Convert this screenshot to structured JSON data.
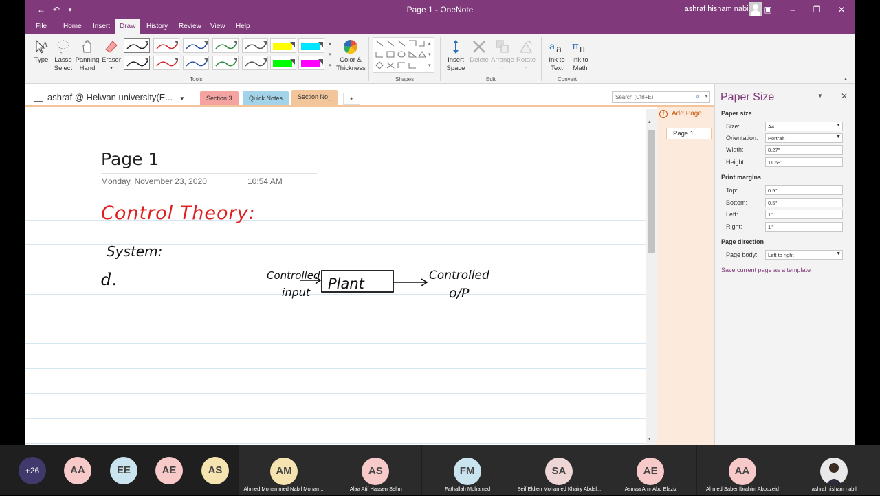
{
  "window": {
    "title": "Page 1  -  OneNote",
    "user": "ashraf hisham nabil"
  },
  "ribbon_tabs": [
    "File",
    "Home",
    "Insert",
    "Draw",
    "History",
    "Review",
    "View",
    "Help"
  ],
  "active_tab": "Draw",
  "ribbon": {
    "type": "Type",
    "lasso": "Lasso\nSelect",
    "lasso_1": "Lasso",
    "lasso_2": "Select",
    "panning_1": "Panning",
    "panning_2": "Hand",
    "eraser": "Eraser",
    "color_1": "Color &",
    "color_2": "Thickness",
    "insert_space_1": "Insert",
    "insert_space_2": "Space",
    "delete": "Delete",
    "arrange": "Arrange",
    "rotate": "Rotate",
    "ink_text_1": "Ink to",
    "ink_text_2": "Text",
    "ink_math_1": "Ink to",
    "ink_math_2": "Math",
    "groups": {
      "tools": "Tools",
      "shapes": "Shapes",
      "edit": "Edit",
      "convert": "Convert"
    },
    "pen_colors": [
      "#222222",
      "#d22a2a",
      "#2c4fa8",
      "#2a8a3a",
      "#555555",
      "#ffff00",
      "#00e5ff",
      "#222222",
      "#d22a2a",
      "#2c4fa8",
      "#2a8a3a",
      "#555555",
      "#00ff00",
      "#ff00ff"
    ]
  },
  "notebook": {
    "name": "ashraf @ Helwan university(E...",
    "sections": [
      {
        "label": "Section 3",
        "color": "#f4a3a0"
      },
      {
        "label": "Quick Notes",
        "color": "#a3d3e8"
      },
      {
        "label": "Section No_",
        "color": "#f2c59b"
      }
    ],
    "add_section": "+",
    "search_placeholder": "Search (Ctrl+E)"
  },
  "page": {
    "title": "Page 1",
    "date": "Monday, November 23, 2020",
    "time": "10:54 AM",
    "ink": {
      "heading": "Control Theory:",
      "system": "System:",
      "d": "d.",
      "controlled": "Controlled",
      "input": "input",
      "plant": "Plant",
      "controlled_out": "Controlled",
      "op": "o/P"
    }
  },
  "pages_panel": {
    "add_page": "Add Page",
    "items": [
      "Page 1"
    ]
  },
  "paper_pane": {
    "title": "Paper Size",
    "paper_size_header": "Paper size",
    "size_label": "Size:",
    "size_value": "A4",
    "orientation_label": "Orientation:",
    "orientation_value": "Portrait",
    "width_label": "Width:",
    "width_value": "8.27\"",
    "height_label": "Height:",
    "height_value": "11.69\"",
    "margins_header": "Print margins",
    "top_label": "Top:",
    "top_value": "0.5\"",
    "bottom_label": "Bottom:",
    "bottom_value": "0.5\"",
    "left_label": "Left:",
    "left_value": "1\"",
    "right_label": "Right:",
    "right_value": "1\"",
    "direction_header": "Page direction",
    "body_label": "Page body:",
    "body_value": "Left to right",
    "template_link": "Save current page as a template"
  },
  "meeting": {
    "more_count": "+26",
    "participants": [
      {
        "initials": "AA",
        "color": "#f7c9c9",
        "name": ""
      },
      {
        "initials": "EE",
        "color": "#c9e3ef",
        "name": ""
      },
      {
        "initials": "AE",
        "color": "#f7c9c9",
        "name": ""
      },
      {
        "initials": "AS",
        "color": "#f6e4b0",
        "name": ""
      },
      {
        "initials": "AM",
        "color": "#f6e4b0",
        "name": "Ahmed Mohammed Nabil Moham..."
      },
      {
        "initials": "AS",
        "color": "#f7c9c9",
        "name": "Alaa Atif Hassen Selim"
      },
      {
        "initials": "FM",
        "color": "#c9e3ef",
        "name": "Fathallah Mohamed"
      },
      {
        "initials": "SA",
        "color": "#efd6d6",
        "name": "Seif Eldien Mohamed Khairy Abdel..."
      },
      {
        "initials": "AE",
        "color": "#f7c9c9",
        "name": "Asmaa Amr Abd Elaziz"
      },
      {
        "initials": "AA",
        "color": "#f7c9c9",
        "name": "Ahmed Saber Ibrahim Abouzeid"
      },
      {
        "initials": "",
        "color": "#ffffff",
        "name": "ashraf hisham nabil"
      }
    ]
  }
}
